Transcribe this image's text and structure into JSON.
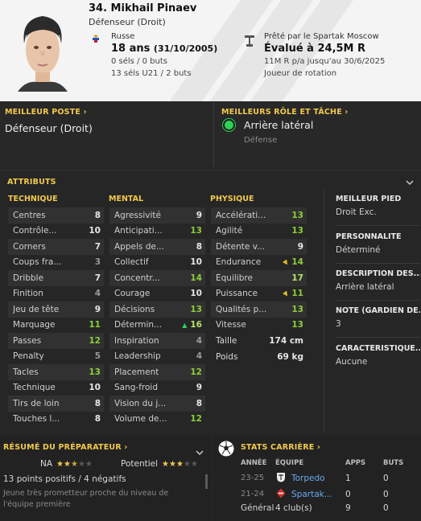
{
  "header": {
    "name": "34. Mikhail Pinaev",
    "position": "Défenseur (Droit)",
    "nation": "Russe",
    "age": "18 ans",
    "dob": "(31/10/2005)",
    "caps": "0 séls / 0 buts",
    "u21": "13 séls U21 / 2 buts",
    "loan": "Prêté par le Spartak Moscow",
    "value": "Évalué à 24,5M R",
    "wage": "11M R p/a jusqu'au 30/6/2025",
    "status": "Joueur de rotation",
    "flag_icon": "russia-flag-icon",
    "loan_icon": "loan-icon"
  },
  "best_position": {
    "title": "MEILLEUR POSTE",
    "value": "Défenseur (Droit)"
  },
  "best_role": {
    "title": "MEILLEURS RÔLE ET TÂCHE",
    "role": "Arrière latéral",
    "duty": "Défense",
    "dot_color": "#2ed158"
  },
  "attributes": {
    "title": "ATTRIBUTS",
    "technical_title": "TECHNIQUE",
    "mental_title": "MENTAL",
    "physical_title": "PHYSIQUE",
    "technical": [
      {
        "label": "Centres",
        "value": "8"
      },
      {
        "label": "Contrôle...",
        "value": "10"
      },
      {
        "label": "Corners",
        "value": "7"
      },
      {
        "label": "Coups fra...",
        "value": "3"
      },
      {
        "label": "Dribble",
        "value": "7"
      },
      {
        "label": "Finition",
        "value": "4"
      },
      {
        "label": "Jeu de tête",
        "value": "9"
      },
      {
        "label": "Marquage",
        "value": "11"
      },
      {
        "label": "Passes",
        "value": "12"
      },
      {
        "label": "Penalty",
        "value": "5"
      },
      {
        "label": "Tacles",
        "value": "13"
      },
      {
        "label": "Technique",
        "value": "10"
      },
      {
        "label": "Tirs de loin",
        "value": "8"
      },
      {
        "label": "Touches l...",
        "value": "8"
      }
    ],
    "mental": [
      {
        "label": "Agressivité",
        "value": "9"
      },
      {
        "label": "Anticipati...",
        "value": "13"
      },
      {
        "label": "Appels de...",
        "value": "8"
      },
      {
        "label": "Collectif",
        "value": "10"
      },
      {
        "label": "Concentr...",
        "value": "14"
      },
      {
        "label": "Courage",
        "value": "10"
      },
      {
        "label": "Décisions",
        "value": "13"
      },
      {
        "label": "Détermin...",
        "value": "16"
      },
      {
        "label": "Inspiration",
        "value": "4"
      },
      {
        "label": "Leadership",
        "value": "4"
      },
      {
        "label": "Placement",
        "value": "12"
      },
      {
        "label": "Sang-froid",
        "value": "9"
      },
      {
        "label": "Vision du j...",
        "value": "8"
      },
      {
        "label": "Volume de...",
        "value": "12"
      }
    ],
    "physical": [
      {
        "label": "Accélérati...",
        "value": "13"
      },
      {
        "label": "Agilité",
        "value": "13"
      },
      {
        "label": "Détente v...",
        "value": "9"
      },
      {
        "label": "Endurance",
        "value": "14"
      },
      {
        "label": "Équilibre",
        "value": "17"
      },
      {
        "label": "Puissance",
        "value": "11"
      },
      {
        "label": "Qualités p...",
        "value": "13"
      },
      {
        "label": "Vitesse",
        "value": "13"
      }
    ],
    "height_label": "Taille",
    "height": "174 cm",
    "weight_label": "Poids",
    "weight": "69 kg"
  },
  "side": {
    "foot_title": "MEILLEUR PIED",
    "foot": "Droit Exc.",
    "personality_title": "PERSONNALITÉ",
    "personality": "Déterminé",
    "description_title": "DESCRIPTION DES...",
    "description": "Arrière latéral",
    "keeper_title": "NOTE (GARDIEN DE...",
    "keeper": "3",
    "traits_title": "CARACTÉRISTIQUE...",
    "traits": "Aucune"
  },
  "coach": {
    "title": "RÉSUMÉ DU PRÉPARATEUR",
    "current_label": "NA",
    "current_stars": 2.5,
    "potential_label": "Potentiel",
    "potential_stars": 3,
    "summary": "13 points positifs / 4 négatifs",
    "description": "Jeune très prometteur proche du niveau de l'équipe première"
  },
  "career": {
    "title": "STATS CARRIÈRE",
    "col_year": "ANNÉE",
    "col_team": "ÉQUIPE",
    "col_apps": "APPS",
    "col_goals": "BUTS",
    "rows": [
      {
        "year": "23-25",
        "team": "Torpedo",
        "apps": "1",
        "goals": "0"
      },
      {
        "year": "21-24",
        "team": "Spartak...",
        "apps": "0",
        "goals": "0"
      }
    ],
    "total_label": "Général",
    "total_clubs": "4 club(s)",
    "total_apps": "9",
    "total_goals": "0"
  }
}
